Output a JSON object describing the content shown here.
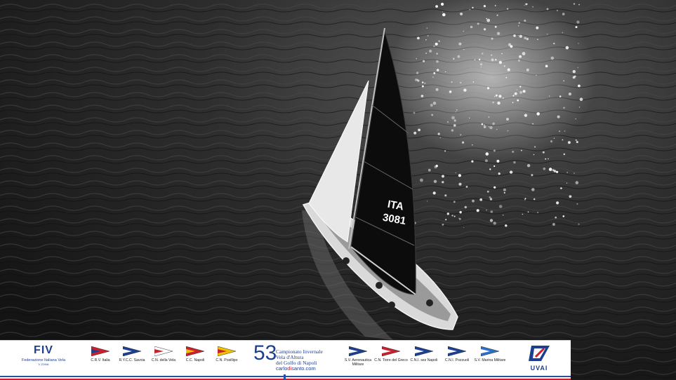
{
  "photo": {
    "description_icon": "sailboat-aerial-photo",
    "sail_number_line1": "ITA",
    "sail_number_line2": "3081"
  },
  "footer": {
    "federation": {
      "wordmark": "FIV",
      "name": "Federazione Italiana Vela",
      "sub": "V ZONA"
    },
    "clubs_left": [
      {
        "label": "C.R.V. Italia",
        "icon": "crv-italia-burgee-icon"
      },
      {
        "label": "R.Y.C.C. Savoia",
        "icon": "rycc-savoia-burgee-icon"
      },
      {
        "label": "C.N. della Vela",
        "icon": "cn-della-vela-burgee-icon"
      },
      {
        "label": "C.C. Napoli",
        "icon": "cc-napoli-burgee-icon"
      },
      {
        "label": "C.N. Posillipo",
        "icon": "cn-posillipo-burgee-icon"
      }
    ],
    "event": {
      "number": "53",
      "line1": "Campionato Invernale",
      "line2": "Vela d'Altura",
      "line3": "del Golfo di Napoli",
      "site_pre": "carlo",
      "site_mid": "di",
      "site_post": "santo.com"
    },
    "clubs_right": [
      {
        "label": "S.V. Aeronautica\nMilitare",
        "icon": "sv-aeronautica-burgee-icon"
      },
      {
        "label": "C.N. Torre del Greco",
        "icon": "cn-torre-del-greco-burgee-icon"
      },
      {
        "label": "C.N.I. sez Napoli",
        "icon": "cni-napoli-burgee-icon"
      },
      {
        "label": "C.N.I. Pozzuoli",
        "icon": "cni-pozzuoli-burgee-icon"
      },
      {
        "label": "S.V. Marina Militare",
        "icon": "sv-marina-militare-burgee-icon"
      }
    ],
    "uvai": {
      "wordmark": "UVAI"
    },
    "colors": {
      "navy": "#1d3f8f",
      "red": "#c8202e",
      "stripe_blue": "#2b4f9e"
    }
  }
}
